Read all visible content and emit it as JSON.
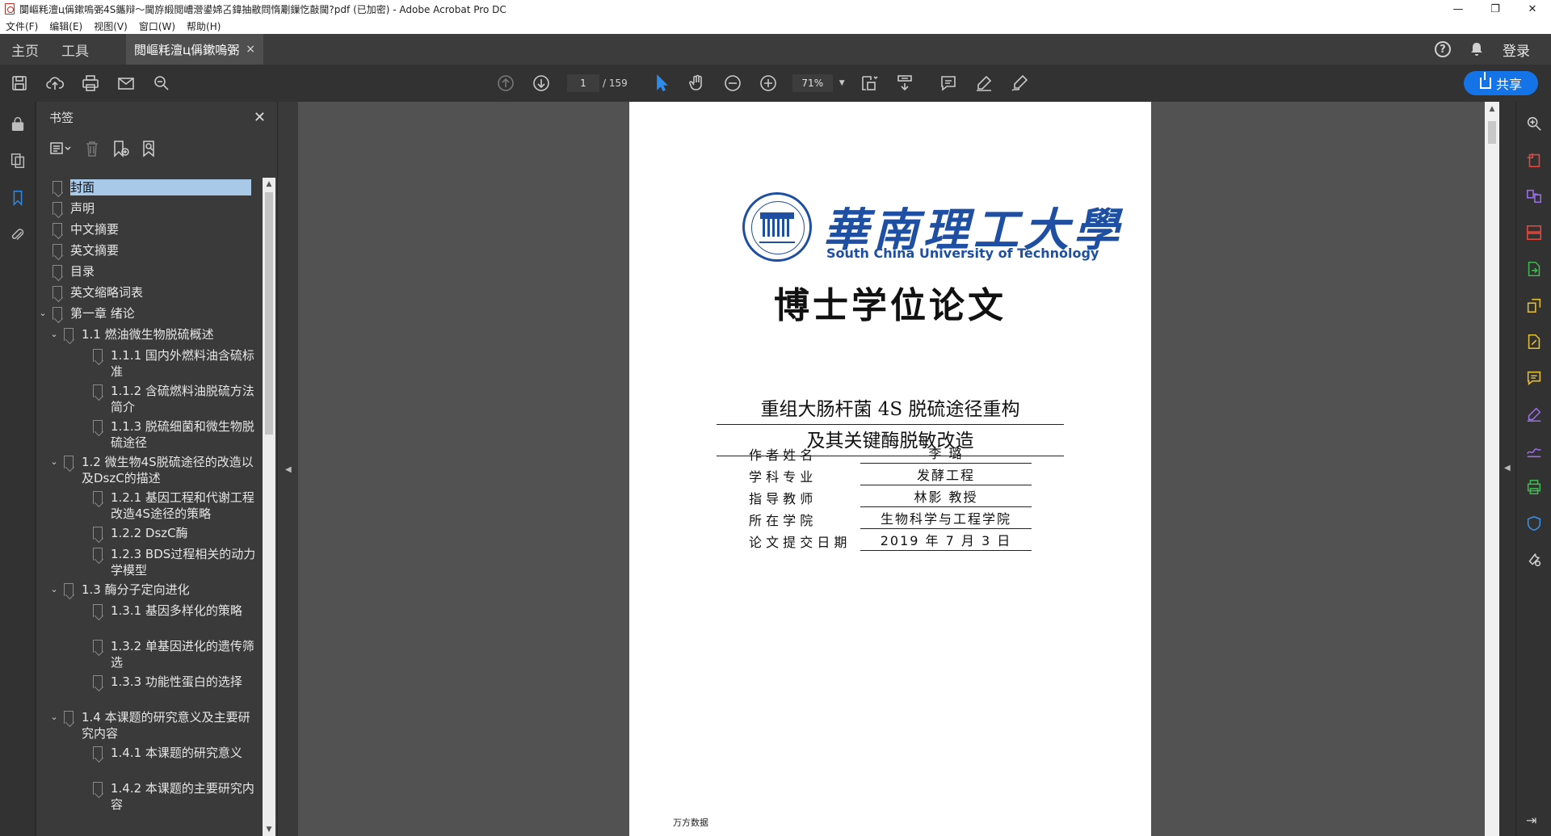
{
  "window": {
    "title": "闅嶇粍澶ц偁鏉嗚弻4S鑴辩～閫斿緞閲嶆瀯鍙婂叾鍏抽敭閰惰劚鏁忔敼閫?pdf  (已加密)  - Adobe Acrobat Pro DC",
    "minimize": "—",
    "restore": "❐",
    "close": "✕"
  },
  "menu": [
    "文件(F)",
    "编辑(E)",
    "视图(V)",
    "窗口(W)",
    "帮助(H)"
  ],
  "tabs": {
    "home": "主页",
    "tools": "工具",
    "document": "閲嶇粍澶ц偁鏉嗚弻...",
    "close": "×",
    "help": "?",
    "login": "登录"
  },
  "toolbar": {
    "page_current": "1",
    "page_total": "/ 159",
    "zoom": "71%",
    "caret": "▼",
    "share": "共享"
  },
  "bookmarks": {
    "title": "书签",
    "close": "✕",
    "items": [
      {
        "label": "封面",
        "level": 0,
        "expand": "",
        "selected": true
      },
      {
        "label": "声明",
        "level": 0,
        "expand": ""
      },
      {
        "label": "中文摘要",
        "level": 0,
        "expand": ""
      },
      {
        "label": "英文摘要",
        "level": 0,
        "expand": ""
      },
      {
        "label": "目录",
        "level": 0,
        "expand": ""
      },
      {
        "label": "英文缩略词表",
        "level": 0,
        "expand": ""
      },
      {
        "label": "第一章 绪论",
        "level": 0,
        "expand": "v"
      },
      {
        "label": "1.1 燃油微生物脱硫概述",
        "level": 1,
        "expand": "v"
      },
      {
        "label": "1.1.1 国内外燃料油含硫标准",
        "level": 2,
        "expand": ""
      },
      {
        "label": "1.1.2 含硫燃料油脱硫方法简介",
        "level": 2,
        "expand": ""
      },
      {
        "label": "1.1.3 脱硫细菌和微生物脱硫途径",
        "level": 2,
        "expand": ""
      },
      {
        "label": "1.2 微生物4S脱硫途径的改造以及DszC的描述",
        "level": 1,
        "expand": "v"
      },
      {
        "label": "1.2.1 基因工程和代谢工程改造4S途径的策略",
        "level": 2,
        "expand": ""
      },
      {
        "label": "1.2.2 DszC酶",
        "level": 2,
        "expand": ""
      },
      {
        "label": "1.2.3 BDS过程相关的动力学模型",
        "level": 2,
        "expand": ""
      },
      {
        "label": "1.3 酶分子定向进化",
        "level": 1,
        "expand": "v"
      },
      {
        "label": "1.3.1 基因多样化的策略",
        "level": 2,
        "expand": ""
      },
      {
        "label": "1.3.2 单基因进化的遗传筛选",
        "level": 2,
        "expand": ""
      },
      {
        "label": "1.3.3 功能性蛋白的选择",
        "level": 2,
        "expand": ""
      },
      {
        "label": "1.4 本课题的研究意义及主要研究内容",
        "level": 1,
        "expand": "v"
      },
      {
        "label": "1.4.1 本课题的研究意义",
        "level": 2,
        "expand": ""
      },
      {
        "label": "1.4.2 本课题的主要研究内容",
        "level": 2,
        "expand": ""
      }
    ]
  },
  "document": {
    "university_cn": "華南理工大學",
    "university_en": "South China University of Technology",
    "degree": "博士学位论文",
    "title_line1": "重组大肠杆菌 4S 脱硫途径重构",
    "title_line2": "及其关键酶脱敏改造",
    "info": [
      {
        "label": "作 者 姓 名",
        "value": "李  璐"
      },
      {
        "label": "学   科   专   业",
        "value": "发酵工程"
      },
      {
        "label": "指   导   教   师",
        "value": "林影  教授"
      },
      {
        "label": "所   在   学   院",
        "value": "生物科学与工程学院"
      },
      {
        "label": "论 文 提 交 日 期",
        "value": "2019 年 7 月 3 日"
      }
    ],
    "watermark": "万方数据"
  },
  "colors": {
    "accent": "#1473e6",
    "logo_blue": "#1e4fa3",
    "bookmark_selected": "#a9c9e8"
  }
}
